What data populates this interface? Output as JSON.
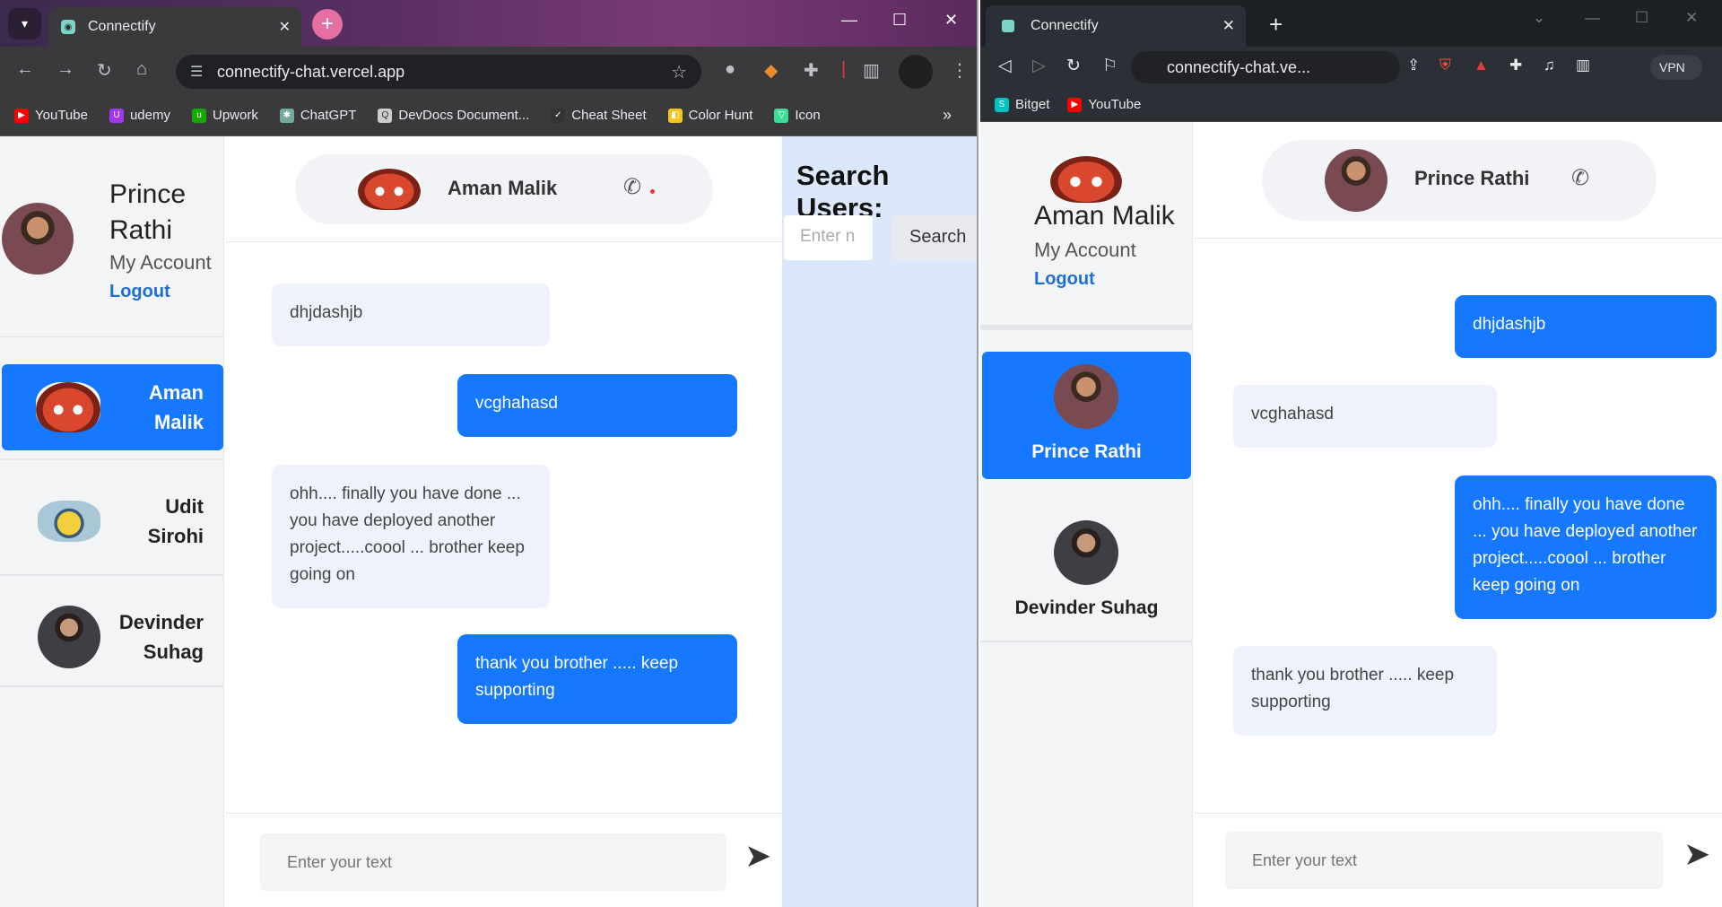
{
  "left_browser": {
    "tab_title": "Connectify",
    "url": "connectify-chat.vercel.app",
    "bookmarks": [
      "YouTube",
      "udemy",
      "Upwork",
      "ChatGPT",
      "DevDocs Document...",
      "Cheat Sheet",
      "Color Hunt",
      "Icon"
    ],
    "bookmark_colors": [
      "#ff0000",
      "#a435f0",
      "#14a800",
      "#74aa9c",
      "#cccccc",
      "#333333",
      "#f5c518",
      "#3ddc97"
    ]
  },
  "right_browser": {
    "tab_title": "Connectify",
    "url": "connectify-chat.ve...",
    "vpn_label": "VPN",
    "bookmarks": [
      "Bitget",
      "YouTube"
    ]
  },
  "left_app": {
    "me": {
      "name_line1": "Prince",
      "name_line2": "Rathi",
      "account": "My Account",
      "logout": "Logout"
    },
    "users": [
      {
        "line1": "Aman",
        "line2": "Malik",
        "active": true
      },
      {
        "line1": "Udit",
        "line2": "Sirohi",
        "active": false
      },
      {
        "line1": "Devinder",
        "line2": "Suhag",
        "active": false
      }
    ],
    "header_name": "Aman Malik",
    "messages": [
      {
        "text": "dhjdashjb",
        "dir": "in"
      },
      {
        "text": "vcghahasd",
        "dir": "out"
      },
      {
        "text": "ohh.... finally you have done ... you have deployed another project.....coool ... brother keep going on",
        "dir": "in"
      },
      {
        "text": "thank you brother ..... keep supporting",
        "dir": "out"
      }
    ],
    "input_placeholder": "Enter your text",
    "search": {
      "title": "Search Users:",
      "placeholder": "Enter n",
      "button": "Search"
    }
  },
  "right_app": {
    "me": {
      "name": "Aman Malik",
      "account": "My Account",
      "logout": "Logout"
    },
    "users": [
      {
        "name": "Prince Rathi",
        "active": true
      },
      {
        "name": "Devinder Suhag",
        "active": false
      }
    ],
    "header_name": "Prince Rathi",
    "messages": [
      {
        "text": "dhjdashjb",
        "dir": "out"
      },
      {
        "text": "vcghahasd",
        "dir": "in"
      },
      {
        "text": "ohh.... finally you have done ... you have deployed another project.....coool ... brother keep going on",
        "dir": "out"
      },
      {
        "text": "thank you brother ..... keep supporting",
        "dir": "in"
      }
    ],
    "input_placeholder": "Enter your text"
  },
  "colors": {
    "accent": "#1677ff",
    "link": "#1d6fd6",
    "incoming": "#eef2fa",
    "search_panel": "#dbe8fb"
  }
}
